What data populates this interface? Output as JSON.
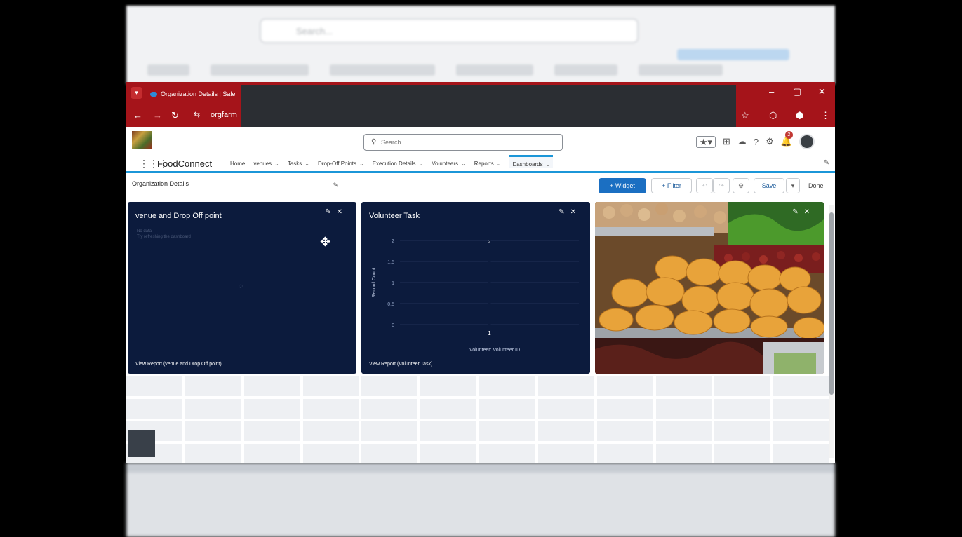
{
  "background": {
    "search_placeholder": "Search..."
  },
  "browser": {
    "tab_title": "Organization Details | Sale",
    "address_prefix": "orgfarm",
    "window_controls": [
      "–",
      "▢",
      "✕"
    ]
  },
  "header": {
    "search_placeholder": "Search...",
    "notification_count": "2"
  },
  "nav": {
    "app_name": "FoodConnect",
    "items": [
      {
        "label": "Home",
        "menu": false
      },
      {
        "label": "venues",
        "menu": true
      },
      {
        "label": "Tasks",
        "menu": true
      },
      {
        "label": "Drop-Off Points",
        "menu": true
      },
      {
        "label": "Execution Details",
        "menu": true
      },
      {
        "label": "Volunteers",
        "menu": true
      },
      {
        "label": "Reports",
        "menu": true
      },
      {
        "label": "Dashboards",
        "menu": true,
        "active": true
      }
    ]
  },
  "toolbar": {
    "dashboard_name": "Organization Details",
    "widget_label": "+ Widget",
    "filter_label": "+ Filter",
    "save_label": "Save",
    "done_label": "Done"
  },
  "widgets": {
    "venue": {
      "title": "venue and Drop Off point",
      "nodata_line1": "No data",
      "nodata_line2": "Try refreshing the dashboard",
      "footer": "View Report (venue and Drop Off point)"
    },
    "volunteer": {
      "title": "Volunteer Task",
      "footer": "View Report (Volunteer Task)"
    }
  },
  "chart_data": {
    "type": "bar",
    "title": "Volunteer Task",
    "xlabel": "Volunteer: Volunteer ID",
    "ylabel": "Record Count",
    "categories": [
      "1"
    ],
    "values": [
      2
    ],
    "ylim": [
      0,
      2
    ],
    "yticks": [
      "2",
      "1.5",
      "1",
      "0.5",
      "0"
    ],
    "grid": true
  },
  "colors": {
    "browser_chrome": "#a5141a",
    "widget_bg": "#0c1b3d",
    "accent": "#1b96d8",
    "primary_button": "#1b6fc2"
  }
}
